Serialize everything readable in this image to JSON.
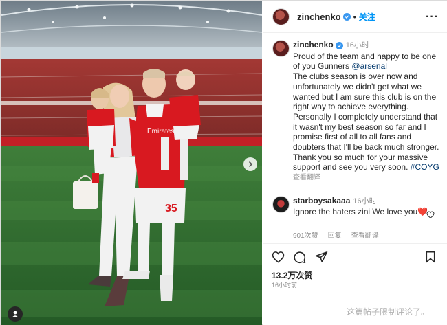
{
  "post": {
    "username": "zinchenko",
    "follow_label": "关注",
    "caption_time": "16小时",
    "caption_text_1": "Proud of the team and happy to be one of you Gunners ",
    "caption_mention": "@arsenal",
    "caption_text_2": "The clubs season is over now and unfortunately we didn't get what we wanted but I am sure this club is on the right way to achieve everything. Personally I completely understand that it wasn't my best season so far and I promise first of all to all fans and doubters that I'll be back much stronger. Thank you so much for your massive support and see you very soon. ",
    "caption_hashtag": "#COYG",
    "translate_label": "查看翻译",
    "likes": "13.2万次赞",
    "posted": "16小时前",
    "comments_disabled": "这篇帖子限制评论了。"
  },
  "comment": {
    "username": "starboysakaaa",
    "time": "16小时",
    "text": "Ignore the haters zini We love you",
    "heart_emoji": "❤️",
    "likes": "901次赞",
    "reply_label": "回复",
    "translate_label": "查看翻译"
  },
  "photo": {
    "jersey_number": "35",
    "sponsor": "Emirates",
    "jersey_color": "#d81920",
    "pitch_color": "#2f6b30"
  },
  "colors": {
    "link": "#00376b",
    "follow": "#0095f6",
    "verified": "#3897f0",
    "muted": "#8e8e8e"
  }
}
